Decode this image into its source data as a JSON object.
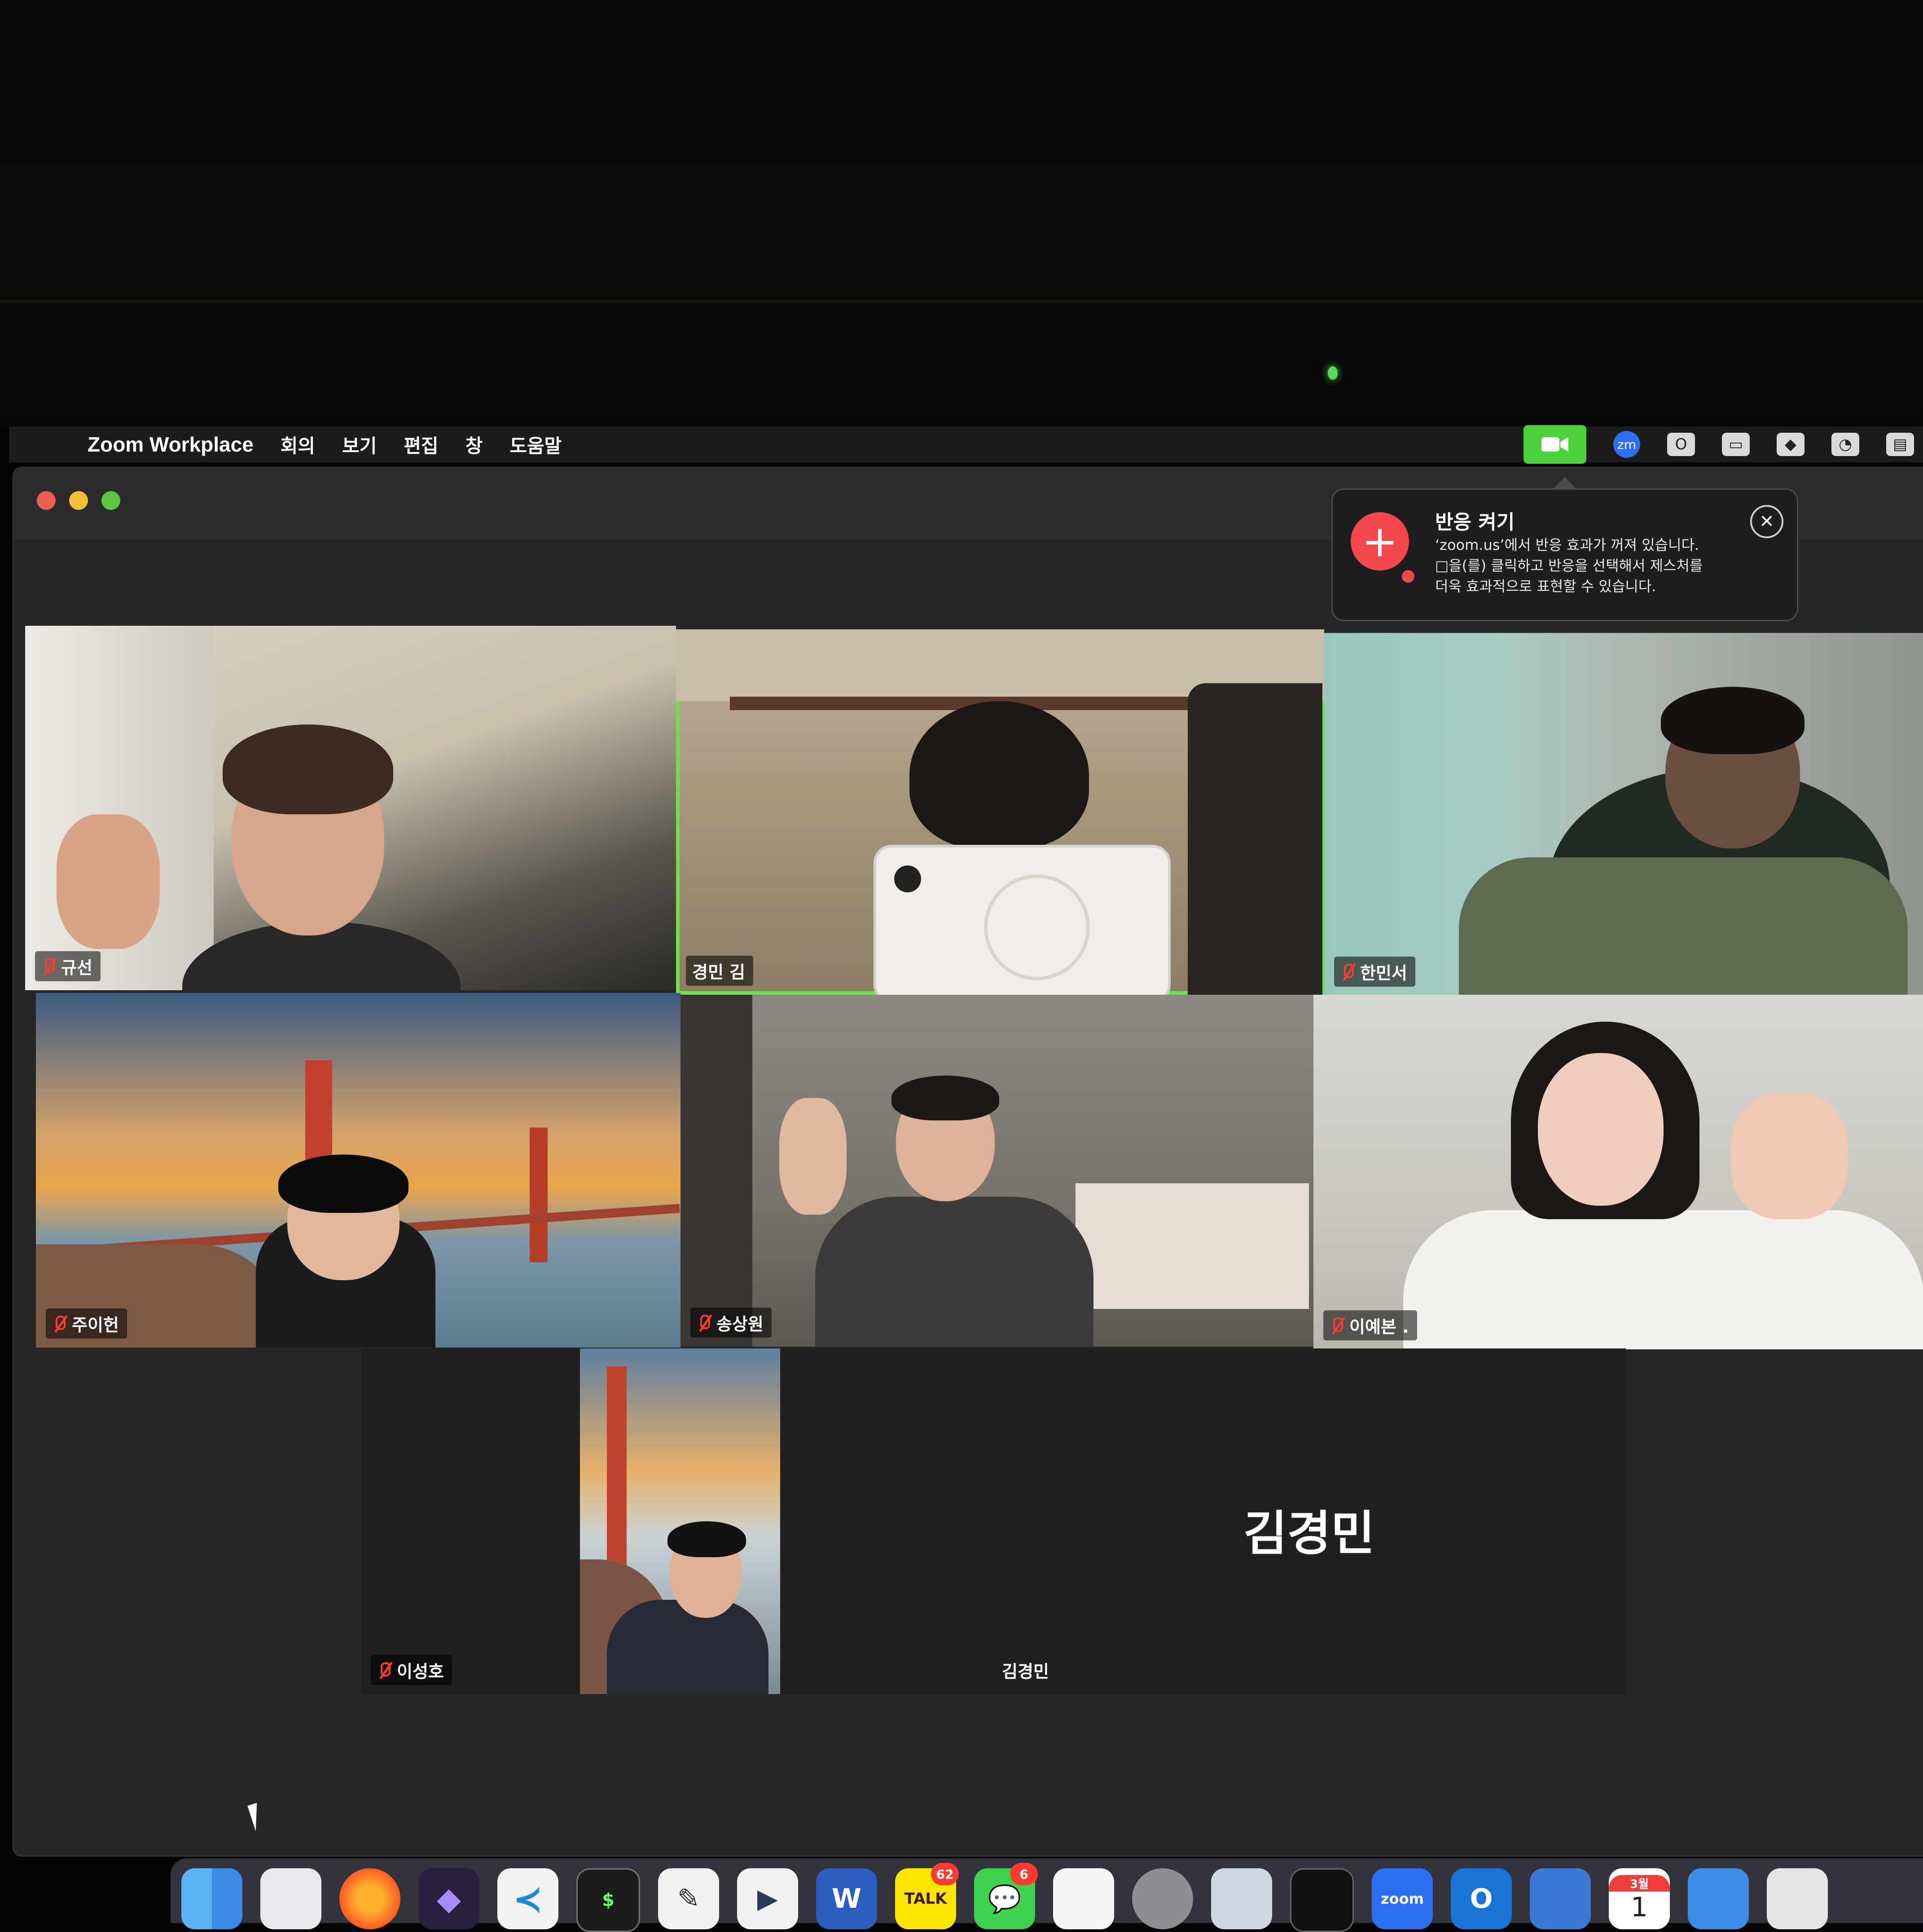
{
  "menubar": {
    "app_name": "Zoom Workplace",
    "items": [
      "회의",
      "보기",
      "편집",
      "창",
      "도움말"
    ]
  },
  "notification": {
    "title": "반응 켜기",
    "lines": [
      "‘zoom.us’에서 반응 효과가 꺼져 있습니다.",
      "□을(를) 클릭하고 반응을 선택해서 제스처를",
      "더욱 효과적으로 표현할 수 있습니다."
    ],
    "close": "✕"
  },
  "participants": [
    {
      "name": "규선",
      "muted": true
    },
    {
      "name": "경민 김",
      "muted": false,
      "active_speaker": true
    },
    {
      "name": "한민서",
      "muted": true
    },
    {
      "name": "주이헌",
      "muted": true
    },
    {
      "name": "송상원",
      "muted": true
    },
    {
      "name": "이예본 .",
      "muted": true
    },
    {
      "name": "이성호",
      "muted": true
    },
    {
      "name": "김경민",
      "muted": false,
      "video_off": true
    }
  ],
  "big_name": "김경민",
  "dock": {
    "messages_badge": "6",
    "kakaotalk_badge": "62",
    "kakaotalk_label": "TALK",
    "zoom_label": "zoom",
    "calendar_month": "3월",
    "calendar_day": "1"
  },
  "colors": {
    "active_speaker_border": "#6be04a",
    "mute_red": "#ff3b30",
    "zoom_status": "#4bd13a"
  }
}
